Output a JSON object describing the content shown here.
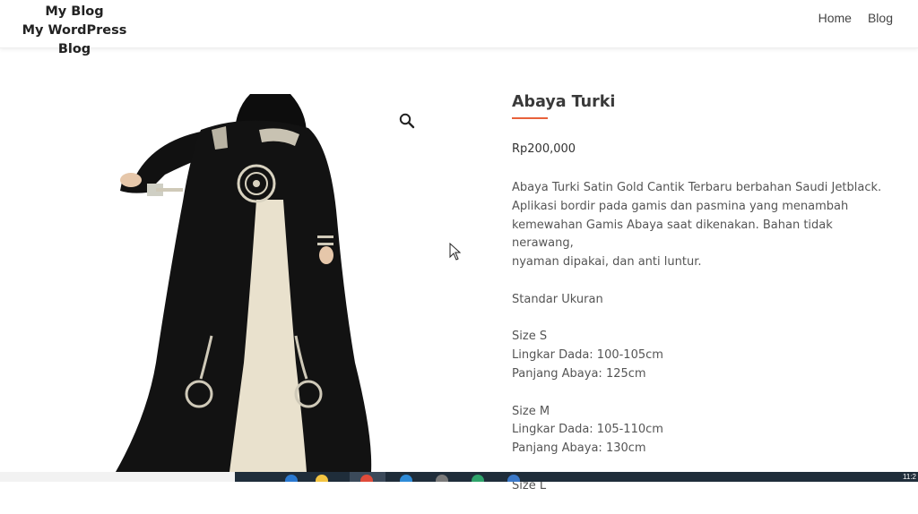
{
  "site": {
    "title": "My Blog",
    "tagline": "My WordPress Blog"
  },
  "nav": {
    "items": [
      "Home",
      "Blog"
    ]
  },
  "product": {
    "title": "Abaya Turki",
    "price": "Rp200,000",
    "image_alt": "Abaya Turki",
    "description": {
      "intro_lines": [
        "Abaya Turki Satin Gold Cantik Terbaru berbahan Saudi Jetblack.",
        "Aplikasi bordir pada gamis dan pasmina yang menambah",
        "kemewahan Gamis Abaya saat dikenakan. Bahan tidak nerawang,",
        "nyaman dipakai, dan anti luntur."
      ],
      "standard_heading": "Standar Ukuran",
      "sizes": [
        {
          "size": "Size S",
          "chest": "Lingkar Dada: 100-105cm",
          "length": "Panjang Abaya: 125cm"
        },
        {
          "size": "Size M",
          "chest": "Lingkar Dada: 105-110cm",
          "length": "Panjang Abaya: 130cm"
        }
      ],
      "next_size": "Size L"
    }
  },
  "taskbar": {
    "clock": "11:2"
  },
  "colors": {
    "accent": "#e8613b",
    "taskbar": "#1f2d3a"
  },
  "icons": {
    "zoom": "magnifier-icon",
    "cursor": "mouse-pointer-icon"
  }
}
